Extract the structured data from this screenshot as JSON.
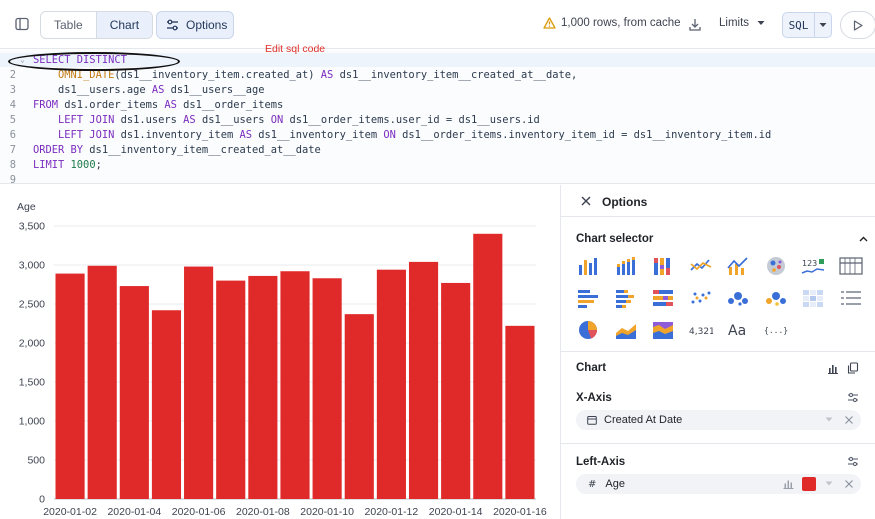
{
  "toolbar": {
    "tabs": [
      {
        "label": "Table"
      },
      {
        "label": "Chart"
      }
    ],
    "options_label": "Options",
    "status_text": "1,000 rows, from cache",
    "limits_label": "Limits",
    "sql_label": "SQL"
  },
  "editor": {
    "annotation": "Edit sql code",
    "line_numbers": [
      "",
      "2",
      "3",
      "4",
      "5",
      "6",
      "7",
      "8",
      "9"
    ],
    "lines": [
      [
        {
          "t": "SELECT DISTINCT",
          "c": "kw"
        }
      ],
      [
        {
          "t": "    ",
          "c": ""
        },
        {
          "t": "OMNI_DATE",
          "c": "fn"
        },
        {
          "t": "(ds1__inventory_item.created_at) ",
          "c": ""
        },
        {
          "t": "AS",
          "c": "kw"
        },
        {
          "t": " ds1__inventory_item__created_at__date,",
          "c": ""
        }
      ],
      [
        {
          "t": "    ds1__users.age ",
          "c": ""
        },
        {
          "t": "AS",
          "c": "kw"
        },
        {
          "t": " ds1__users__age",
          "c": ""
        }
      ],
      [
        {
          "t": "FROM",
          "c": "kw"
        },
        {
          "t": " ds1.order_items ",
          "c": ""
        },
        {
          "t": "AS",
          "c": "kw"
        },
        {
          "t": " ds1__order_items",
          "c": ""
        }
      ],
      [
        {
          "t": "    ",
          "c": ""
        },
        {
          "t": "LEFT JOIN",
          "c": "kw"
        },
        {
          "t": " ds1.users ",
          "c": ""
        },
        {
          "t": "AS",
          "c": "kw"
        },
        {
          "t": " ds1__users ",
          "c": ""
        },
        {
          "t": "ON",
          "c": "kw"
        },
        {
          "t": " ds1__order_items.user_id = ds1__users.id",
          "c": ""
        }
      ],
      [
        {
          "t": "    ",
          "c": ""
        },
        {
          "t": "LEFT JOIN",
          "c": "kw"
        },
        {
          "t": " ds1.inventory_item ",
          "c": ""
        },
        {
          "t": "AS",
          "c": "kw"
        },
        {
          "t": " ds1__inventory_item ",
          "c": ""
        },
        {
          "t": "ON",
          "c": "kw"
        },
        {
          "t": " ds1__order_items.inventory_item_id = ds1__inventory_item.id",
          "c": ""
        }
      ],
      [
        {
          "t": "ORDER BY",
          "c": "kw"
        },
        {
          "t": " ds1__inventory_item__created_at__date",
          "c": ""
        }
      ],
      [
        {
          "t": "LIMIT",
          "c": "kw"
        },
        {
          "t": " ",
          "c": ""
        },
        {
          "t": "1000",
          "c": "nm"
        },
        {
          "t": ";",
          "c": ""
        }
      ],
      []
    ]
  },
  "chart_data": {
    "type": "bar",
    "ylabel": "Age",
    "ylim": [
      0,
      3500
    ],
    "yticks": [
      "0",
      "500",
      "1,000",
      "1,500",
      "2,000",
      "2,500",
      "3,000",
      "3,500"
    ],
    "grid": true,
    "bar_color": "#e02a2a",
    "categories": [
      "2020-01-02",
      "2020-01-03",
      "2020-01-04",
      "2020-01-05",
      "2020-01-06",
      "2020-01-07",
      "2020-01-08",
      "2020-01-09",
      "2020-01-10",
      "2020-01-11",
      "2020-01-12",
      "2020-01-13",
      "2020-01-14",
      "2020-01-15",
      "2020-01-16"
    ],
    "xtick_labels": [
      "2020-01-02",
      "",
      "2020-01-04",
      "",
      "2020-01-06",
      "",
      "2020-01-08",
      "",
      "2020-01-10",
      "",
      "2020-01-12",
      "",
      "2020-01-14",
      "",
      "2020-01-16"
    ],
    "values": [
      2890,
      2990,
      2730,
      2420,
      2980,
      2800,
      2860,
      2920,
      2830,
      2370,
      2940,
      3040,
      2770,
      3400,
      2220
    ]
  },
  "options_panel": {
    "title": "Options",
    "chart_selector_title": "Chart selector",
    "chart_types": [
      "bar-chart-icon",
      "stacked-bar-chart-icon",
      "grid-bar-chart-icon",
      "line-chart-icon",
      "bar-line-combo-icon",
      "map-icon",
      "kpi-trend-icon",
      "table-chart-icon",
      "horizontal-bar-icon",
      "horizontal-stacked-bar-icon",
      "horizontal-grid-bar-icon",
      "scatter-icon",
      "bubble-icon",
      "colored-bubble-icon",
      "heatmap-icon",
      "list-icon",
      "pie-chart-icon",
      "area-chart-icon",
      "stacked-area-icon",
      "number-icon",
      "text-icon",
      "code-icon"
    ],
    "number_glyph": "4,321",
    "text_glyph": "Aa",
    "code_glyph": "{...}",
    "kpi_glyph": "123",
    "chart_section_title": "Chart",
    "x_axis_title": "X-Axis",
    "x_axis_field": "Created At Date",
    "left_axis_title": "Left-Axis",
    "left_axis_field": "Age",
    "left_axis_glyph": "#",
    "series_color": "#e02a2a"
  }
}
